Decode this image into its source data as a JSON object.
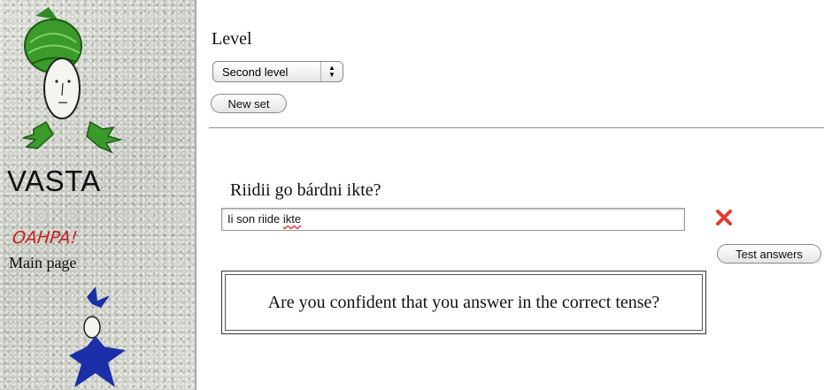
{
  "sidebar": {
    "title": "VASTA",
    "oahpa_link": "OAHPA!",
    "main_page_link": "Main page"
  },
  "level": {
    "label": "Level",
    "selected": "Second level"
  },
  "buttons": {
    "new_set": "New set",
    "test_answers": "Test answers"
  },
  "exercise": {
    "question": "Riidii go bárdni ikte?",
    "answer_before_error": "Ii son riide ",
    "answer_misspelled_word": "ikte",
    "result_icon": "wrong-answer-x-icon",
    "feedback": "Are you confident that you answer in the correct tense?"
  },
  "colors": {
    "oahpa_red": "#c82020",
    "error_red": "#e53b2e",
    "mascot_green": "#3a9a2a",
    "star_blue": "#1b2fa8"
  }
}
